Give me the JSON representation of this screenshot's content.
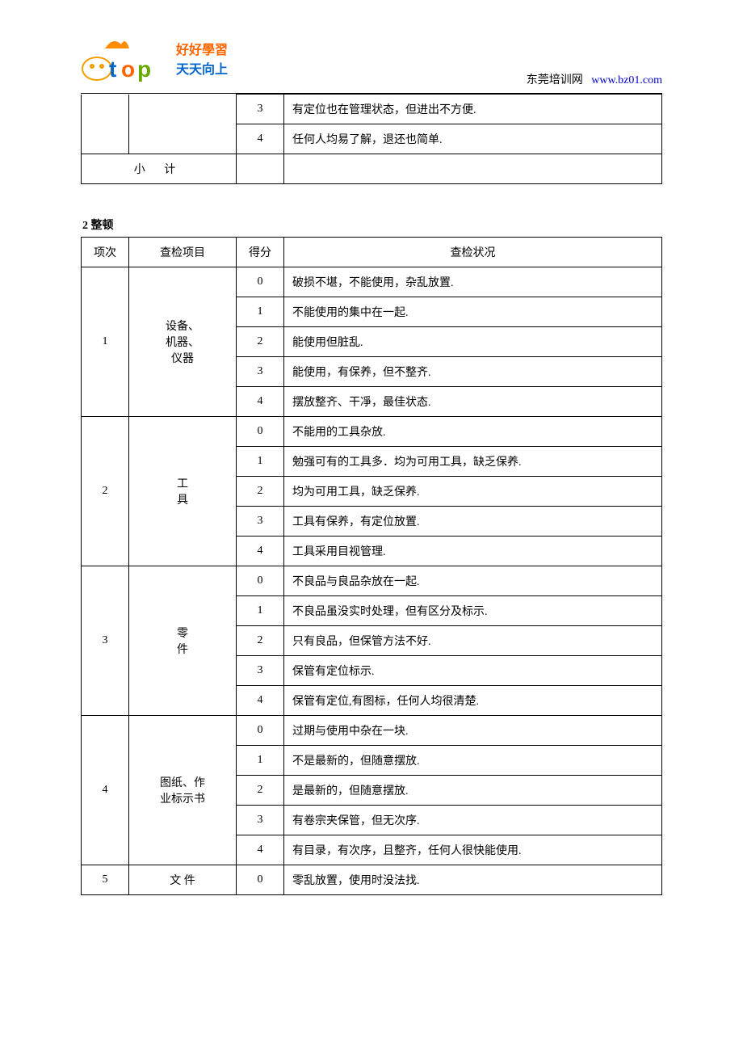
{
  "header": {
    "slogan1": "好好學習",
    "slogan2": "天天向上",
    "site_name": "东莞培训网",
    "site_url": "www.bz01.com"
  },
  "table1": {
    "rows": [
      {
        "score": "3",
        "desc": "有定位也在管理状态，但进出不方便."
      },
      {
        "score": "4",
        "desc": "任何人均易了解，退还也简单."
      }
    ],
    "subtotal_label": "小  计"
  },
  "section2": {
    "title": "2 整顿",
    "headers": {
      "num": "项次",
      "item": "查检项目",
      "score": "得分",
      "desc": "查检状况"
    },
    "groups": [
      {
        "num": "1",
        "item": "设备、\n机器、\n仪器",
        "rows": [
          {
            "score": "0",
            "desc": "破损不堪，不能使用，杂乱放置."
          },
          {
            "score": "1",
            "desc": "不能使用的集中在一起."
          },
          {
            "score": "2",
            "desc": "能使用但脏乱."
          },
          {
            "score": "3",
            "desc": "能使用，有保养，但不整齐."
          },
          {
            "score": "4",
            "desc": "摆放整齐、干凈，最佳状态."
          }
        ]
      },
      {
        "num": "2",
        "item": "工\n具",
        "rows": [
          {
            "score": "0",
            "desc": "不能用的工具杂放."
          },
          {
            "score": "1",
            "desc": "勉强可有的工具多．均为可用工具，缺乏保养."
          },
          {
            "score": "2",
            "desc": "均为可用工具，缺乏保养."
          },
          {
            "score": "3",
            "desc": "工具有保养，有定位放置."
          },
          {
            "score": "4",
            "desc": "工具采用目视管理."
          }
        ]
      },
      {
        "num": "3",
        "item": "零\n件",
        "rows": [
          {
            "score": "0",
            "desc": "不良品与良品杂放在一起."
          },
          {
            "score": "1",
            "desc": "不良品虽没实时处理，但有区分及标示."
          },
          {
            "score": "2",
            "desc": "只有良品，但保管方法不好."
          },
          {
            "score": "3",
            "desc": "保管有定位标示."
          },
          {
            "score": "4",
            "desc": "保管有定位,有图标，任何人均很清楚."
          }
        ]
      },
      {
        "num": "4",
        "item": "图纸、作\n业标示书",
        "rows": [
          {
            "score": "0",
            "desc": "过期与使用中杂在一块."
          },
          {
            "score": "1",
            "desc": "不是最新的，但随意摆放."
          },
          {
            "score": "2",
            "desc": "是最新的，但随意摆放."
          },
          {
            "score": "3",
            "desc": "有卷宗夹保管，但无次序."
          },
          {
            "score": "4",
            "desc": "有目录，有次序，且整齐，任何人很快能使用."
          }
        ]
      },
      {
        "num": "5",
        "item": "文  件",
        "rows": [
          {
            "score": "0",
            "desc": "零乱放置，使用时没法找."
          }
        ]
      }
    ]
  }
}
